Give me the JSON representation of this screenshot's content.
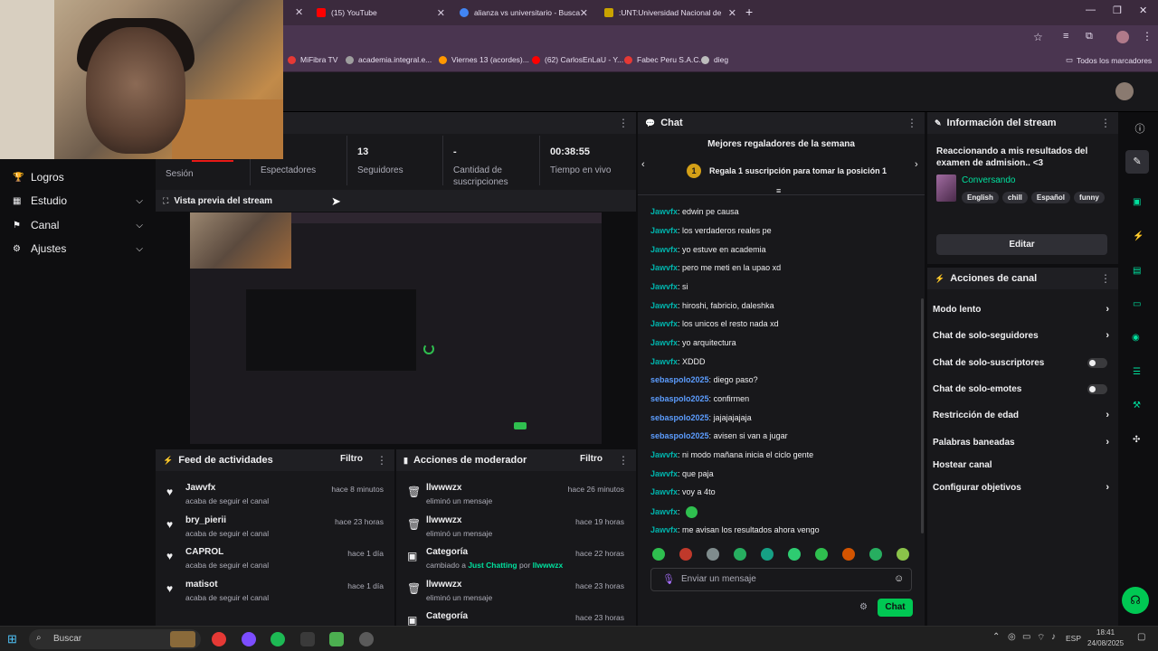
{
  "browser": {
    "tabs": [
      {
        "label": "(15) YouTube",
        "color": "#ff0000"
      },
      {
        "label": "alianza vs universitario - Busca",
        "color": "#4285f4"
      },
      {
        "label": ":UNT:Universidad Nacional de",
        "color": "#c9a300"
      }
    ],
    "new_tab": "+",
    "bookmarks": [
      {
        "label": "MiFibra TV",
        "color": "#e53935"
      },
      {
        "label": "academia.integral.e...",
        "color": "#9e9e9e"
      },
      {
        "label": "Viernes 13 (acordes)...",
        "color": "#ff9800"
      },
      {
        "label": "(62) CarlosEnLaU - Y...",
        "color": "#ff0000"
      },
      {
        "label": "Fabec Peru S.A.C.",
        "color": "#e53935"
      },
      {
        "label": "dieg",
        "color": "#bdbdbd"
      }
    ],
    "all_bookmarks": "Todos los marcadores"
  },
  "sidebar": {
    "items": [
      {
        "label": "Logros",
        "icon": "trophy-icon",
        "glyph": "🏆"
      },
      {
        "label": "Estudio",
        "icon": "film-icon",
        "glyph": "▦"
      },
      {
        "label": "Canal",
        "icon": "flag-icon",
        "glyph": "⚑"
      },
      {
        "label": "Ajustes",
        "icon": "gear-icon",
        "glyph": "⚙"
      }
    ]
  },
  "stats": {
    "session_label": "Sesión",
    "viewers_label": "Espectadores",
    "followers_value": "13",
    "followers_label": "Seguidores",
    "subs_value": "-",
    "subs_label": "Cantidad de suscripciones",
    "time_value": "00:38:55",
    "time_label": "Tiempo en vivo"
  },
  "preview": {
    "title": "Vista previa del stream"
  },
  "feed": {
    "title": "Feed de actividades",
    "filter": "Filtro",
    "items": [
      {
        "name": "Jawvfx",
        "desc": "acaba de seguir el canal",
        "time": "hace 8 minutos"
      },
      {
        "name": "bry_pierii",
        "desc": "acaba de seguir el canal",
        "time": "hace 23 horas"
      },
      {
        "name": "CAPROL",
        "desc": "acaba de seguir el canal",
        "time": "hace 1 día"
      },
      {
        "name": "matisot",
        "desc": "acaba de seguir el canal",
        "time": "hace 1 día"
      }
    ]
  },
  "mod": {
    "title": "Acciones de moderador",
    "filter": "Filtro",
    "items": [
      {
        "name": "llwwwzx",
        "desc": "eliminó un mensaje",
        "time": "hace 26 minutos",
        "icon": "trash-icon"
      },
      {
        "name": "llwwwzx",
        "desc": "eliminó un mensaje",
        "time": "hace 19 horas",
        "icon": "trash-icon"
      },
      {
        "name": "Categoría",
        "desc_pre": "cambiado a ",
        "desc_cat": "Just Chatting",
        "desc_mid": " por ",
        "desc_user": "llwwwzx",
        "time": "hace 22 horas",
        "icon": "category-icon"
      },
      {
        "name": "llwwwzx",
        "desc": "eliminó un mensaje",
        "time": "hace 23 horas",
        "icon": "trash-icon"
      },
      {
        "name": "Categoría",
        "desc": "",
        "time": "hace 23 horas",
        "icon": "category-icon"
      }
    ]
  },
  "chat": {
    "title": "Chat",
    "gifters_title": "Mejores regaladores de la semana",
    "gift_rank": "1",
    "gift_cta": "Regala 1 suscripción para tomar la posición 1",
    "messages": [
      {
        "user": "Jawvfx",
        "text": "edwin pe causa",
        "color": "#00b5ad"
      },
      {
        "user": "Jawvfx",
        "text": "los verdaderos reales pe",
        "color": "#00b5ad"
      },
      {
        "user": "Jawvfx",
        "text": "yo estuve en academia",
        "color": "#00b5ad"
      },
      {
        "user": "Jawvfx",
        "text": "pero me meti en la upao xd",
        "color": "#00b5ad"
      },
      {
        "user": "Jawvfx",
        "text": "si",
        "color": "#00b5ad"
      },
      {
        "user": "Jawvfx",
        "text": "hiroshi, fabricio, daleshka",
        "color": "#00b5ad"
      },
      {
        "user": "Jawvfx",
        "text": "los unicos el resto nada xd",
        "color": "#00b5ad"
      },
      {
        "user": "Jawvfx",
        "text": "yo arquitectura",
        "color": "#00b5ad"
      },
      {
        "user": "Jawvfx",
        "text": "XDDD",
        "color": "#00b5ad"
      },
      {
        "user": "sebaspolo2025",
        "text": "diego paso?",
        "color": "#5c9dff"
      },
      {
        "user": "sebaspolo2025",
        "text": "confirmen",
        "color": "#5c9dff"
      },
      {
        "user": "sebaspolo2025",
        "text": "jajajajajaja",
        "color": "#5c9dff"
      },
      {
        "user": "sebaspolo2025",
        "text": "avisen si van a jugar",
        "color": "#5c9dff"
      },
      {
        "user": "Jawvfx",
        "text": "ni modo mañana inicia el ciclo gente",
        "color": "#00b5ad"
      },
      {
        "user": "Jawvfx",
        "text": "que paja",
        "color": "#00b5ad"
      },
      {
        "user": "Jawvfx",
        "text": "voy a 4to",
        "color": "#00b5ad"
      },
      {
        "user": "Jawvfx",
        "text": "",
        "color": "#00b5ad"
      },
      {
        "user": "Jawvfx",
        "text": "me avisan los resultados ahora vengo",
        "color": "#00b5ad"
      }
    ],
    "input_placeholder": "Enviar un mensaje",
    "send_label": "Chat"
  },
  "info": {
    "title": "Información del stream",
    "stream_title": "Reaccionando a mis resultados del examen de admision.. <3",
    "category": "Conversando",
    "tags": [
      "English",
      "chill",
      "Español",
      "funny"
    ],
    "edit_label": "Editar"
  },
  "actions": {
    "title": "Acciones de canal",
    "items": [
      {
        "label": "Modo lento",
        "kind": "arrow"
      },
      {
        "label": "Chat de solo-seguidores",
        "kind": "arrow"
      },
      {
        "label": "Chat de solo-suscriptores",
        "kind": "toggle"
      },
      {
        "label": "Chat de solo-emotes",
        "kind": "toggle"
      },
      {
        "label": "Restricción de edad",
        "kind": "arrow"
      },
      {
        "label": "Palabras baneadas",
        "kind": "arrow"
      },
      {
        "label": "Hostear canal",
        "kind": "none"
      },
      {
        "label": "Configurar objetivos",
        "kind": "arrow"
      }
    ]
  },
  "taskbar": {
    "search_placeholder": "Buscar",
    "lang": "ESP",
    "time": "18:41",
    "date": "24/08/2025"
  },
  "colors": {
    "accent": "#00e09e",
    "panel": "#18181b",
    "background": "#0e0e10"
  }
}
